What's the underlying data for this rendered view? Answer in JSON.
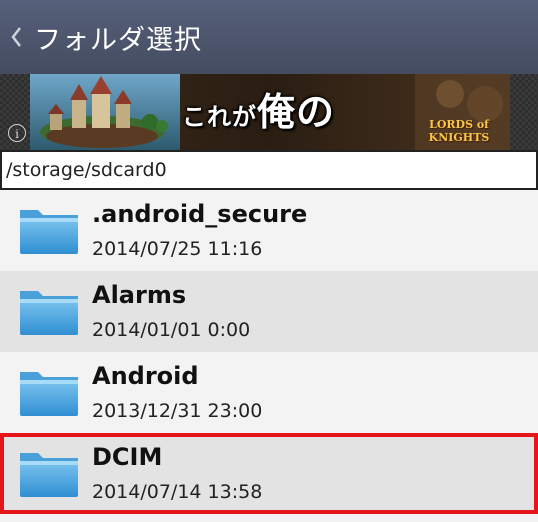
{
  "actionbar": {
    "title": "フォルダ選択",
    "back_icon": "chevron-left-icon"
  },
  "ad": {
    "headline_main": "これが",
    "headline_big": "俺の城…!?",
    "logo_text": "LORDS of KNIGHTS",
    "info_icon": "info-icon"
  },
  "path": {
    "current": "/storage/sdcard0"
  },
  "folders": [
    {
      "name": ".android_secure",
      "date": "2014/07/25 11:16"
    },
    {
      "name": "Alarms",
      "date": "2014/01/01 0:00"
    },
    {
      "name": "Android",
      "date": "2013/12/31 23:00"
    },
    {
      "name": "DCIM",
      "date": "2014/07/14 13:58",
      "selected": true
    }
  ],
  "colors": {
    "actionbar": "#4a5266",
    "highlight": "#e8141c",
    "folder": "#3f9ad6"
  }
}
